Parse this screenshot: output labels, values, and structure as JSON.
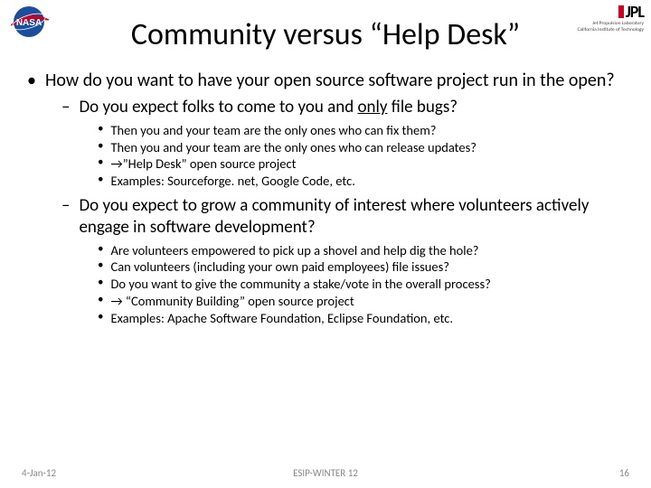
{
  "title": "Community versus “Help Desk”",
  "logos": {
    "nasa": "nasa-logo",
    "jpl_text": "JPL",
    "jpl_sub1": "Jet Propulsion Laboratory",
    "jpl_sub2": "California Institute of Technology"
  },
  "bullets": {
    "b1": "How do you want to have your open source software project run in the open?",
    "b1a_pre": "Do you expect folks to come to you and ",
    "b1a_u": "only",
    "b1a_post": " file bugs?",
    "b1a1": "Then you and your team are the only ones who can fix them?",
    "b1a2": "Then you and your team are the only ones who can release updates?",
    "b1a3": "→”Help Desk” open source project",
    "b1a4": "Examples: Sourceforge. net, Google Code, etc.",
    "b1b": "Do you expect to grow a community of interest where volunteers actively engage in software development?",
    "b1b1": "Are volunteers empowered to pick up a shovel and help dig the hole?",
    "b1b2": "Can volunteers (including your own paid employees) file issues?",
    "b1b3": "Do you want to give the community a stake/vote in the overall process?",
    "b1b4": "→ “Community Building” open source project",
    "b1b5": "Examples: Apache Software Foundation, Eclipse Foundation, etc."
  },
  "footer": {
    "date": "4-Jan-12",
    "venue": "ESIP-WINTER 12",
    "page": "16"
  }
}
